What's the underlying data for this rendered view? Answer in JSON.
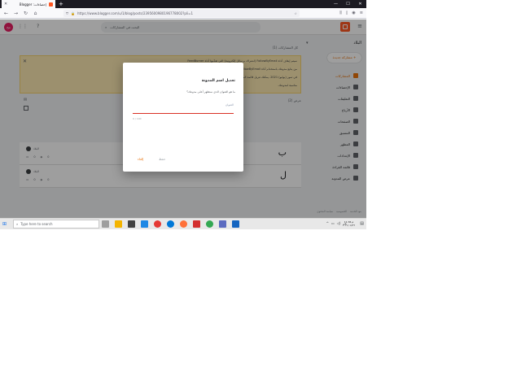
{
  "browser": {
    "tab_title": "إحصاءات: Blogger",
    "new_tab": "+",
    "url": "https://www.blogger.com/u/1/blog/posts/2395600980196778002?pli=1"
  },
  "app": {
    "avatar_initials": "مح",
    "search_placeholder": "البحث في المشاركات",
    "blog_name": "البلاد",
    "new_post": "+ مشاركة جديدة",
    "breadcrumb": "كل المشاركات (1)",
    "notice_lines": [
      "سيتم إيقاف أداة FollowByEmail (اشتراك برسائل إلكترونية) التي تقدّمها أداة FeedBurner",
      "من يتابع مدونتك باستخدام أداة FollowByEmail سيتوقف عن تلقّي رسائل إلكترونية تلقائية بالمشاركات الجديدة",
      "في تموز (يوليو) 2021. يمكنك تنزيل قائمة المشتركين وإعداد خدمة بديلة",
      "مناسبة لمدونتك."
    ],
    "list_count": "عرض (2)"
  },
  "sidebar": {
    "items": [
      {
        "label": "المشاركات",
        "active": true
      },
      {
        "label": "الإحصاءات",
        "active": false
      },
      {
        "label": "التعليقات",
        "active": false
      },
      {
        "label": "الأرباح",
        "active": false
      },
      {
        "label": "الصفحات",
        "active": false
      },
      {
        "label": "التنسيق",
        "active": false
      },
      {
        "label": "المظهر",
        "active": false
      },
      {
        "label": "الإعدادات",
        "active": false
      },
      {
        "label": "قائمة القراءة",
        "active": false
      },
      {
        "label": "عرض المدونة",
        "active": false
      }
    ],
    "footer": [
      "بنود الخدمة",
      "الخصوصية",
      "سياسة المحتوى"
    ]
  },
  "posts": [
    {
      "letter": "ب",
      "author": "البلاد",
      "views": "0",
      "comments": "0"
    },
    {
      "letter": "ل",
      "author": "البلاد",
      "views": "0",
      "comments": "0"
    }
  ],
  "dialog": {
    "title": "تعديل اسم المدونة",
    "description": "ما هو العنوان الذي ستظهر أعلى مدونتك؟",
    "field_label": "العنوان",
    "field_value": "",
    "counter": "0 / 100",
    "save_label": "حفظ",
    "cancel_label": "إلغاء"
  },
  "taskbar": {
    "search_placeholder": "Type here to search",
    "lang": "عر",
    "time": "11:36 م",
    "date": "٢٠٢١/٠٥/٢٦"
  },
  "colors": {
    "accent": "#e8710a",
    "blogger_orange": "#ff5722",
    "notice_bg": "#fce8b2",
    "error": "#d93025"
  }
}
